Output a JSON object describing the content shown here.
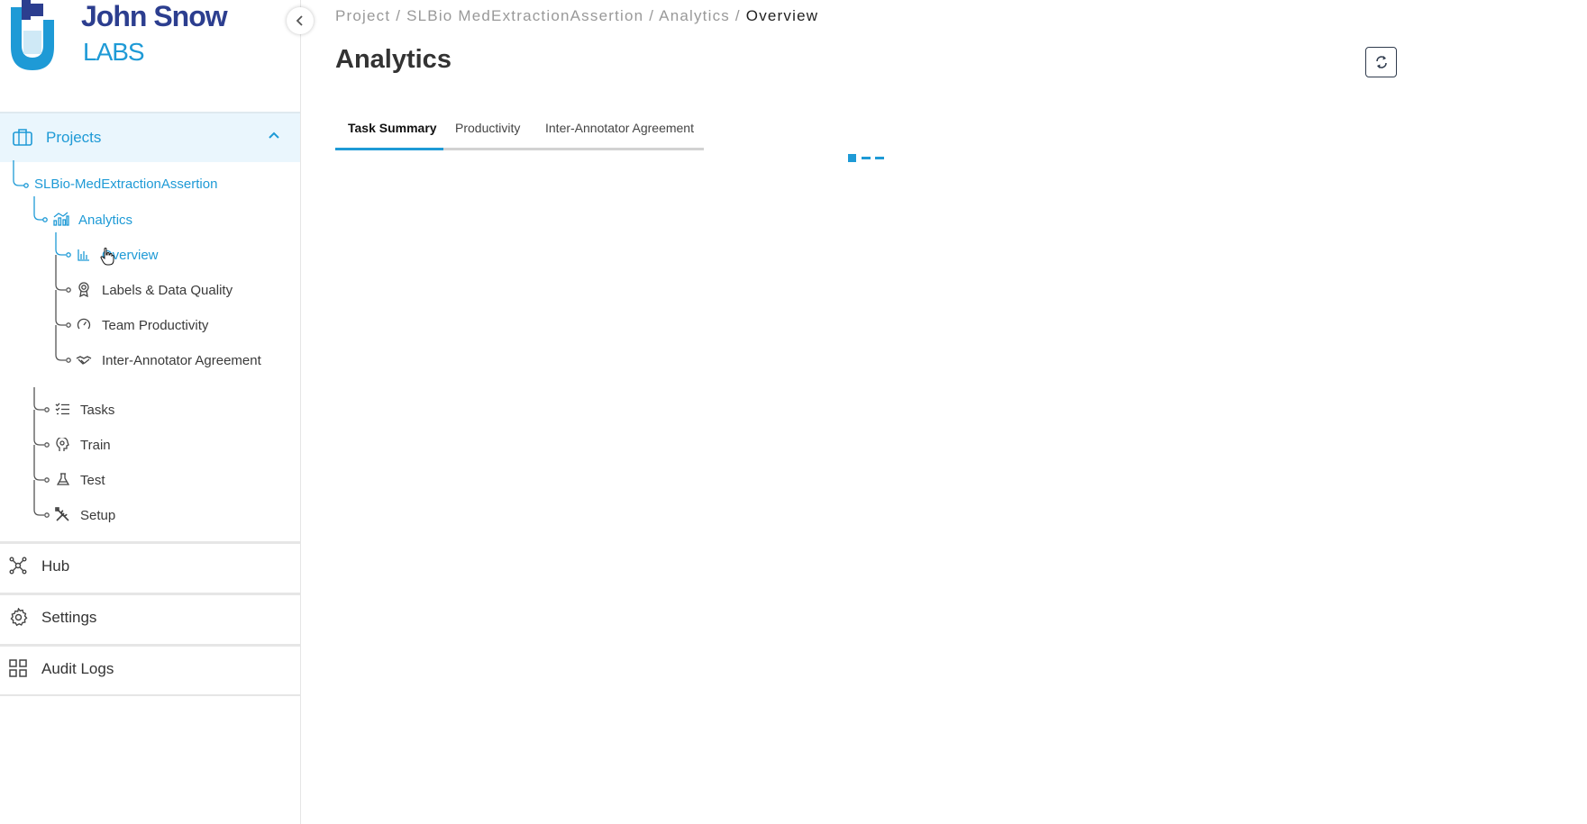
{
  "brand": {
    "line1": "John Snow",
    "line2": "LABS"
  },
  "sidebar": {
    "projects_label": "Projects",
    "tree": {
      "project": "SLBio-MedExtractionAssertion",
      "analytics": "Analytics",
      "analytics_items": [
        {
          "label": "Overview",
          "icon": "bar-chart-icon",
          "active": true
        },
        {
          "label": "Labels & Data Quality",
          "icon": "badge-icon"
        },
        {
          "label": "Team Productivity",
          "icon": "speedometer-icon"
        },
        {
          "label": "Inter-Annotator Agreement",
          "icon": "handshake-icon"
        }
      ],
      "project_items": [
        {
          "label": "Tasks",
          "icon": "checklist-icon"
        },
        {
          "label": "Train",
          "icon": "brain-icon"
        },
        {
          "label": "Test",
          "icon": "flask-icon"
        },
        {
          "label": "Setup",
          "icon": "tools-icon"
        }
      ]
    },
    "sections": [
      {
        "label": "Hub",
        "icon": "hub-icon"
      },
      {
        "label": "Settings",
        "icon": "gear-icon"
      },
      {
        "label": "Audit Logs",
        "icon": "grid-icon"
      }
    ]
  },
  "breadcrumb": {
    "part1": "Project /",
    "part2": "SLBio MedExtractionAssertion /",
    "part3": "Analytics /",
    "current": "Overview"
  },
  "page": {
    "title": "Analytics"
  },
  "tabs": [
    "Task Summary",
    "Productivity",
    "Inter-Annotator Agreement"
  ],
  "colors": {
    "accent": "#1e9ad6",
    "brand_dark": "#2c3e8f",
    "active_bg": "#eaf6fd"
  }
}
